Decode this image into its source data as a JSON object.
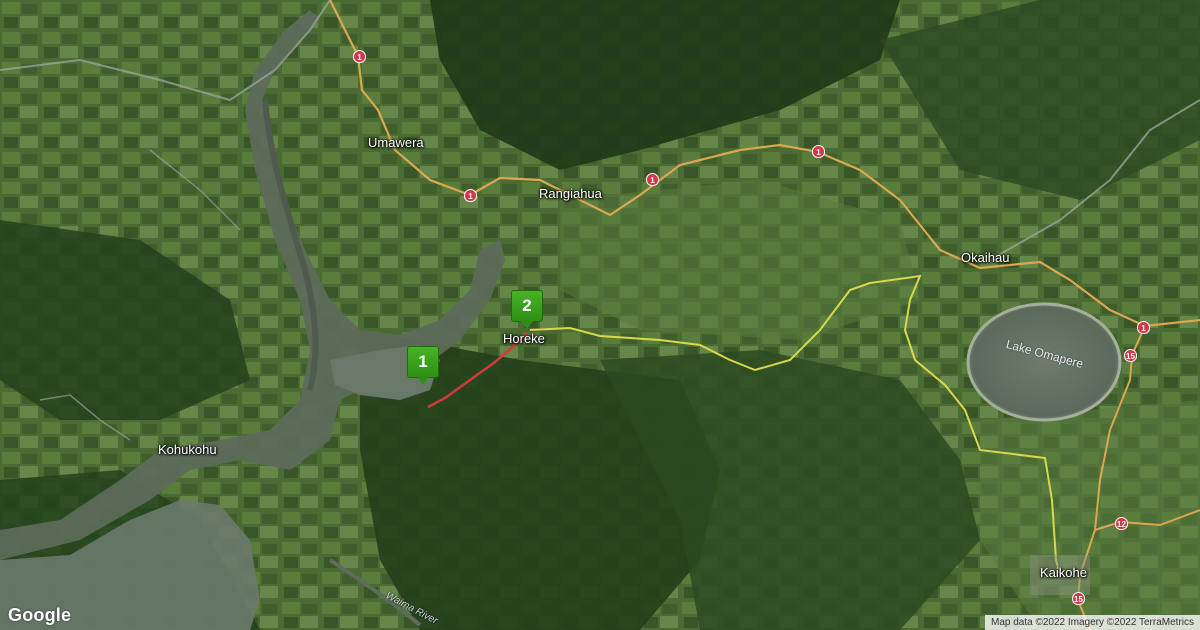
{
  "map": {
    "type": "satellite",
    "places": [
      {
        "id": "umawera",
        "label": "Umawera"
      },
      {
        "id": "rangiahua",
        "label": "Rangiahua"
      },
      {
        "id": "horeke",
        "label": "Horeke"
      },
      {
        "id": "okaihau",
        "label": "Okaihau"
      },
      {
        "id": "kohukohu",
        "label": "Kohukohu"
      },
      {
        "id": "kaikohe",
        "label": "Kaikohe"
      }
    ],
    "lake_label": "Lake Omapere",
    "river_label": "Waima River",
    "route_shields": [
      "1",
      "1",
      "1",
      "1",
      "1",
      "15",
      "15",
      "12"
    ],
    "markers": [
      {
        "label": "1"
      },
      {
        "label": "2"
      }
    ],
    "colors": {
      "route": "#d8d84a",
      "track": "#d23a3a",
      "marker": "#3aa31b",
      "shield": "#d2384a",
      "road": "#d9a850"
    }
  },
  "logo": "Google",
  "attribution": "Map data ©2022 Imagery ©2022 TerraMetrics"
}
